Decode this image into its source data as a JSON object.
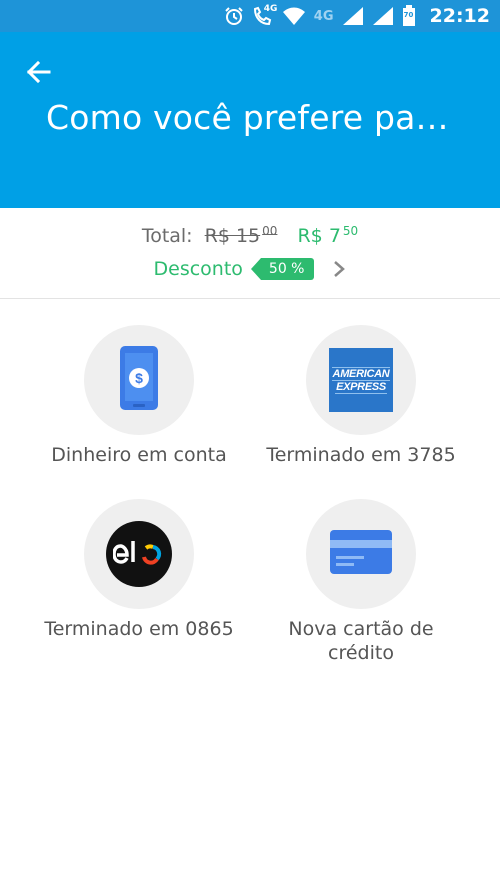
{
  "status_bar": {
    "network_1": "4G",
    "network_2": "4G",
    "battery_level": "70",
    "time": "22:12",
    "icons": [
      "alarm-icon",
      "wifi-calling-icon",
      "wifi-icon",
      "signal-icon",
      "signal-icon",
      "battery-icon"
    ]
  },
  "app_bar": {
    "title": "Como você prefere paga...",
    "back_icon": "arrow-left-icon",
    "color": "#00a0e6"
  },
  "summary": {
    "total_label": "Total:",
    "old_price": "R$ 15",
    "old_price_cents": "00",
    "new_price": "R$ 7",
    "new_price_cents": "50",
    "discount_label": "Desconto",
    "discount_badge": "50 %",
    "accent_color": "#2dbb6f"
  },
  "payment_options": [
    {
      "label": "Dinheiro em conta",
      "icon": "phone-money-icon"
    },
    {
      "label": "Terminado em 3785",
      "icon": "american-express-icon",
      "brand_lines": [
        "AMERICAN",
        "EXPRESS"
      ]
    },
    {
      "label": "Terminado em 0865",
      "icon": "elo-icon",
      "brand": "elo"
    },
    {
      "label": "Nova cartão de crédito",
      "icon": "credit-card-icon"
    }
  ]
}
